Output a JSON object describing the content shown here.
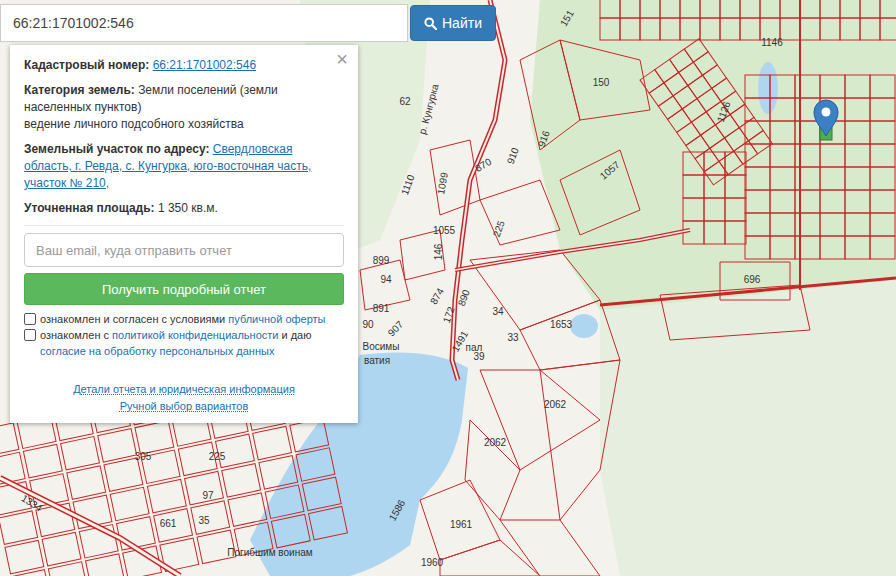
{
  "search": {
    "value": "66:21:1701002:546",
    "button": "Найти"
  },
  "info": {
    "close": "×",
    "fields": [
      {
        "label": "Кадастровый номер:",
        "value": "66:21:1701002:546",
        "link": true,
        "note": ""
      },
      {
        "label": "Категория земель:",
        "value": "Земли поселений (земли населенных пунктов)",
        "link": false,
        "note": "ведение личного подсобного хозяйства"
      },
      {
        "label": "Земельный участок по адресу:",
        "value": "Свердловская область, г. Ревда, с. Кунгурка, юго-восточная часть, участок № 210,",
        "link": true,
        "note": ""
      },
      {
        "label": "Уточненная площадь:",
        "value": "1 350 кв.м.",
        "link": false,
        "note": ""
      }
    ],
    "email_placeholder": "Ваш email, куда отправить отчет",
    "submit": "Получить подробный отчет",
    "checkboxes": [
      {
        "checked": false,
        "parts": [
          {
            "text": "ознакомлен и согласен с условиями ",
            "link": false
          },
          {
            "text": "публичной оферты",
            "link": true
          }
        ]
      },
      {
        "checked": false,
        "parts": [
          {
            "text": "ознакомлен с ",
            "link": false
          },
          {
            "text": "политикой конфиденциальности",
            "link": true
          },
          {
            "text": " и даю ",
            "link": false
          },
          {
            "text": "согласие на обработку персональных данных",
            "link": true
          }
        ]
      }
    ],
    "links": [
      "Детали отчета и юридическая информация",
      "Ручной выбор вариантов"
    ]
  },
  "map": {
    "labels": [
      {
        "text": "151"
      },
      {
        "text": "1146"
      },
      {
        "text": "150"
      },
      {
        "text": "1126"
      },
      {
        "text": "62"
      },
      {
        "text": "р. Кунгурка"
      },
      {
        "text": "910"
      },
      {
        "text": "916"
      },
      {
        "text": "870"
      },
      {
        "text": "1057"
      },
      {
        "text": "1110"
      },
      {
        "text": "1099"
      },
      {
        "text": "1055"
      },
      {
        "text": "146"
      },
      {
        "text": "225"
      },
      {
        "text": "899"
      },
      {
        "text": "696"
      },
      {
        "text": "94"
      },
      {
        "text": "891"
      },
      {
        "text": "874"
      },
      {
        "text": "172"
      },
      {
        "text": "890"
      },
      {
        "text": "34"
      },
      {
        "text": "1653"
      },
      {
        "text": "90"
      },
      {
        "text": "907"
      },
      {
        "text": "1491"
      },
      {
        "text": "33"
      },
      {
        "text": "Восимы"
      },
      {
        "text": "пал"
      },
      {
        "text": "ватия"
      },
      {
        "text": "39"
      },
      {
        "text": "2062"
      },
      {
        "text": "2062"
      },
      {
        "text": "305"
      },
      {
        "text": "225"
      },
      {
        "text": "97"
      },
      {
        "text": "661"
      },
      {
        "text": "35"
      },
      {
        "text": "1586"
      },
      {
        "text": "1961"
      },
      {
        "text": "1960"
      },
      {
        "text": "1334"
      },
      {
        "text": "Погибшим воинам"
      }
    ]
  }
}
